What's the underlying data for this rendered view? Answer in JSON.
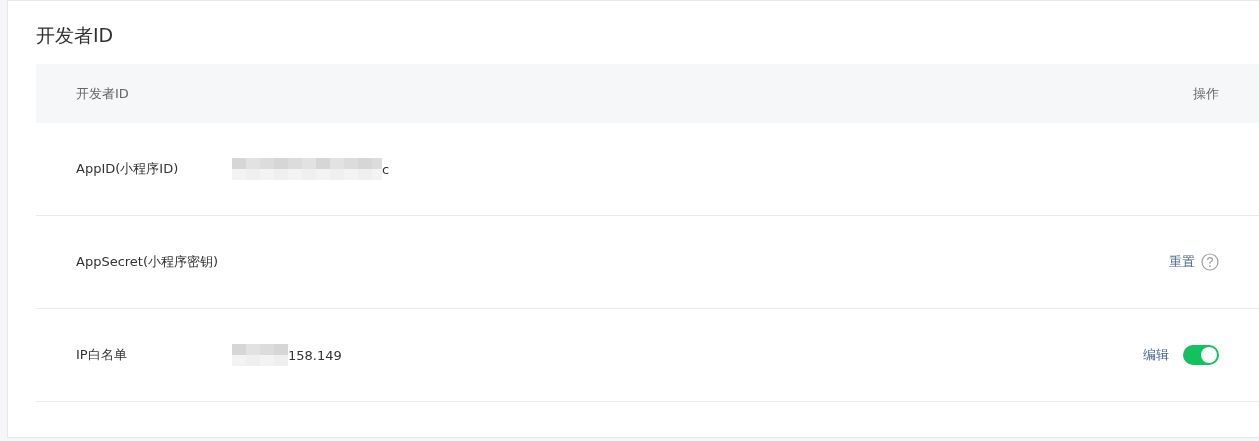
{
  "section": {
    "title": "开发者ID"
  },
  "table": {
    "columns": [
      "开发者ID",
      "操作"
    ],
    "rows": [
      {
        "label": "AppID(小程序ID)",
        "value": "c",
        "masked": true,
        "actions": []
      },
      {
        "label": "AppSecret(小程序密钥)",
        "masked": false,
        "actions": [
          {
            "kind": "link",
            "label": "重置"
          },
          {
            "kind": "help"
          }
        ]
      },
      {
        "label": "IP白名单",
        "value": "158.149",
        "masked": true,
        "actions": [
          {
            "kind": "link",
            "label": "编辑"
          },
          {
            "kind": "switch",
            "on": true
          }
        ]
      }
    ]
  }
}
